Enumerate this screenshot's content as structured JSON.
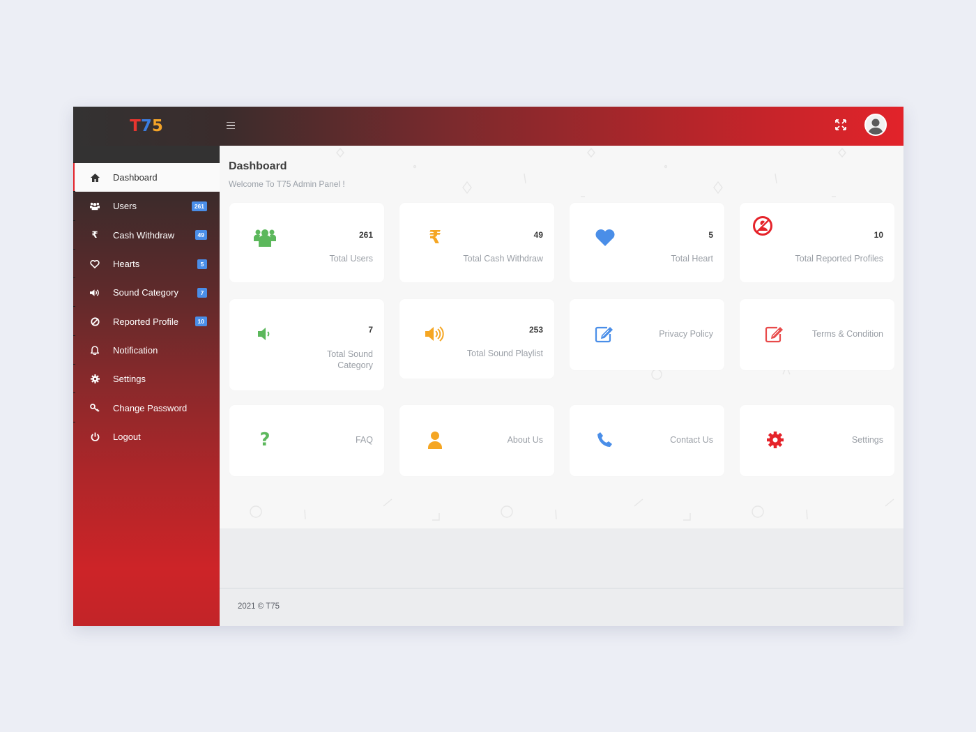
{
  "brand": {
    "t": "T",
    "seven": "7",
    "five": "5"
  },
  "topbar": {
    "menu_icon": "hamburger-icon",
    "fullscreen_icon": "expand-icon",
    "avatar_icon": "user-avatar-icon"
  },
  "sidebar": {
    "items": [
      {
        "label": "Dashboard",
        "icon": "home-icon",
        "active": true
      },
      {
        "label": "Users",
        "icon": "users-icon",
        "badge": "261"
      },
      {
        "label": "Cash Withdraw",
        "icon": "rupee-icon",
        "badge": "49"
      },
      {
        "label": "Hearts",
        "icon": "heart-icon",
        "badge": "5"
      },
      {
        "label": "Sound Category",
        "icon": "volume-icon",
        "badge": "7"
      },
      {
        "label": "Reported Profile",
        "icon": "ban-icon",
        "badge": "10"
      },
      {
        "label": "Notification",
        "icon": "bell-icon"
      },
      {
        "label": "Settings",
        "icon": "gear-icon"
      },
      {
        "label": "Change Password",
        "icon": "key-icon"
      },
      {
        "label": "Logout",
        "icon": "power-icon"
      }
    ]
  },
  "main": {
    "title": "Dashboard",
    "subtitle": "Welcome To T75 Admin Panel !",
    "cards": [
      {
        "value": "261",
        "label": "Total Users",
        "icon": "users-icon",
        "color": "#5cb85c"
      },
      {
        "value": "49",
        "label": "Total Cash Withdraw",
        "icon": "rupee-icon",
        "color": "#f5a623"
      },
      {
        "value": "5",
        "label": "Total Heart",
        "icon": "heart-icon",
        "color": "#4a8ee8"
      },
      {
        "value": "10",
        "label": "Total Reported Profiles",
        "icon": "blocked-user-icon",
        "color": "#e5232a"
      },
      {
        "value": "7",
        "label_line1": "Total Sound",
        "label_line2": "Category",
        "icon": "volume-low-icon",
        "color": "#5cb85c"
      },
      {
        "value": "253",
        "label": "Total Sound Playlist",
        "icon": "volume-high-icon",
        "color": "#f5a623"
      },
      {
        "label": "Privacy Policy",
        "icon": "edit-icon",
        "color": "#4a8ee8"
      },
      {
        "label": "Terms & Condition",
        "icon": "edit-icon",
        "color": "#e84a4a"
      },
      {
        "label": "FAQ",
        "icon": "question-icon",
        "color": "#5cb85c"
      },
      {
        "label": "About Us",
        "icon": "user-icon",
        "color": "#f5a623"
      },
      {
        "label": "Contact Us",
        "icon": "phone-icon",
        "color": "#4a8ee8"
      },
      {
        "label": "Settings",
        "icon": "gear-icon",
        "color": "#e5232a"
      }
    ]
  },
  "footer": {
    "text": "2021 © T75"
  },
  "colors": {
    "accent": "#e2232a",
    "badge": "#4a8ee8",
    "sidebar_top": "#333232"
  }
}
